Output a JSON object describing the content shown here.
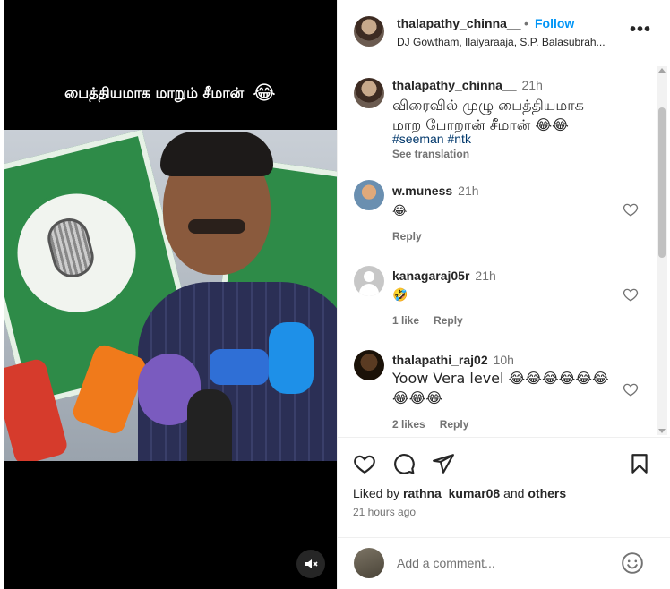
{
  "video": {
    "overlay_caption": "பைத்தியமாக மாறும் சீமான்",
    "overlay_emoji": "😂",
    "mute_icon": "speaker-muted-icon"
  },
  "header": {
    "username": "thalapathy_chinna__",
    "separator": "•",
    "follow_label": "Follow",
    "audio_credit": "DJ Gowtham, Ilaiyaraaja, S.P. Balasubrah...",
    "more_icon": "•••"
  },
  "caption": {
    "username": "thalapathy_chinna__",
    "time": "21h",
    "text": "விரைவில் முழு பைத்தியமாக மாற போறான் சீமான் 😂😂",
    "hashtags": "#seeman #ntk",
    "see_translation": "See translation"
  },
  "comments": [
    {
      "username": "w.muness",
      "time": "21h",
      "text": "😂",
      "reply_label": "Reply"
    },
    {
      "username": "kanagaraj05r",
      "time": "21h",
      "text": "🤣",
      "likes": "1 like",
      "reply_label": "Reply"
    },
    {
      "username": "thalapathi_raj02",
      "time": "10h",
      "text": "Yoow Vera level 😂😂😂😂😂😂😂😂😂",
      "likes": "2 likes",
      "reply_label": "Reply"
    }
  ],
  "actions": {
    "liked_prefix": "Liked by",
    "liked_user": "rathna_kumar08",
    "liked_and": "and",
    "liked_others": "others",
    "time_ago": "21 hours ago"
  },
  "add_comment": {
    "placeholder": "Add a comment..."
  },
  "colors": {
    "follow_blue": "#0095f6",
    "hashtag_blue": "#00376b",
    "muted_text": "#737373"
  }
}
